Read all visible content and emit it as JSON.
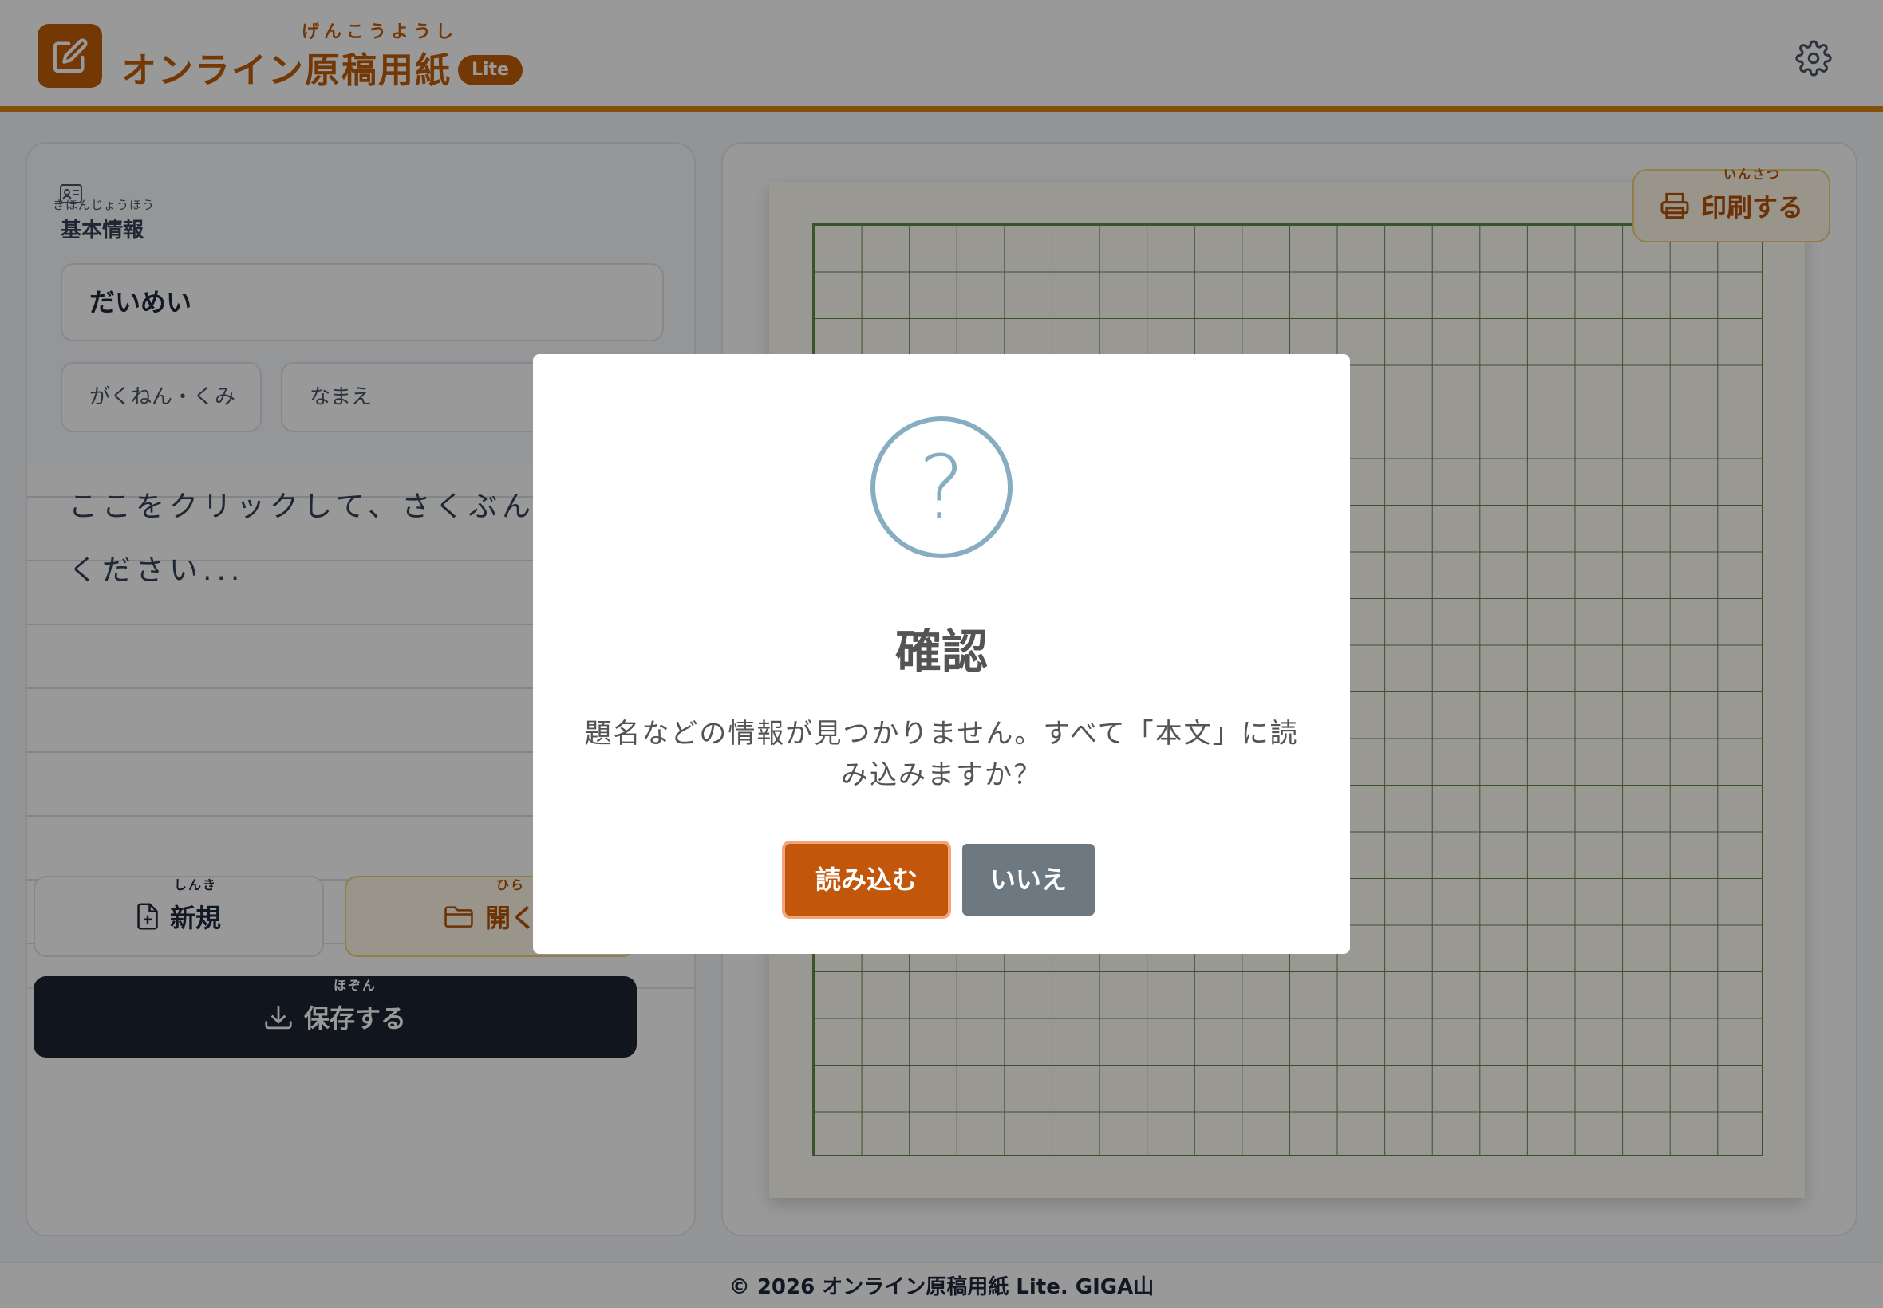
{
  "header": {
    "title_ruby": "げんこうようし",
    "title": "オンライン原稿用紙",
    "badge": "Lite"
  },
  "left_panel": {
    "info_ruby": "きほんじょうほう",
    "info_heading": "基本情報",
    "title_field_value": "だいめい",
    "class_field_value": "がくねん・くみ",
    "name_field_value": "なまえ",
    "body_placeholder": "ここをクリックして、さくぶんを書いてください...",
    "buttons": {
      "new_ruby": "しんき",
      "new_label": "新規",
      "open_ruby": "ひら",
      "open_label": "開く",
      "save_ruby": "ほぞん",
      "save_label": "保存する"
    }
  },
  "right_panel": {
    "print_ruby": "いんさつ",
    "print_label": "印刷する"
  },
  "footer": {
    "text": "© 2026 オンライン原稿用紙 Lite. GIGA山"
  },
  "dialog": {
    "icon": "question-icon",
    "icon_glyph": "?",
    "title": "確認",
    "message": "題名などの情報が見つかりません。すべて「本文」に読み込みますか？",
    "confirm_label": "読み込む",
    "deny_label": "いいえ"
  },
  "colors": {
    "accent": "#c25e08",
    "header_border": "#d9860f",
    "grid": "#5f8a4a",
    "icon_circle": "#87adc3",
    "deny_button": "#6e7881",
    "save_button": "#1c2333"
  }
}
